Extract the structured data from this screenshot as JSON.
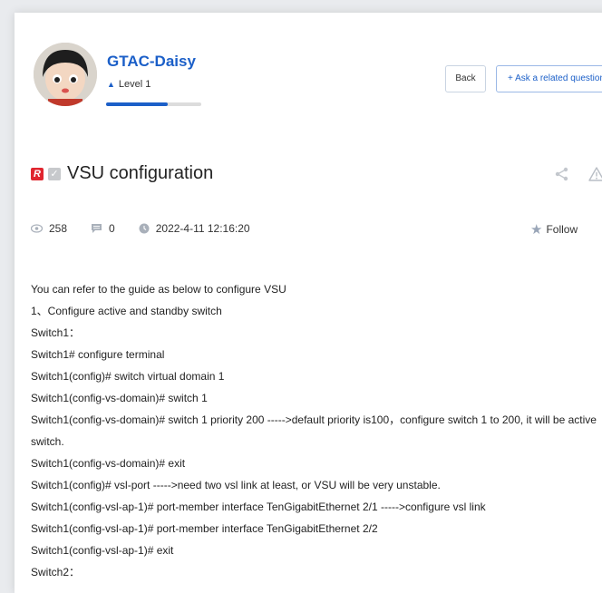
{
  "user": {
    "name": "GTAC-Daisy",
    "level": "Level 1",
    "level_progress": 0.65
  },
  "actions": {
    "back_label": "Back",
    "ask_label": "+ Ask a related question"
  },
  "post": {
    "title": "VSU configuration",
    "views": "258",
    "comments": "0",
    "datetime": "2022-4-11 12:16:20",
    "follow_label": "Follow"
  },
  "icons": {
    "brand_logo": "R",
    "checkbox": "✓",
    "share": "share-icon",
    "warning": "warning-icon"
  },
  "content_lines": [
    "You can refer to the guide as below to configure VSU",
    "1、Configure  active and standby switch",
    "Switch1：",
    "Switch1# configure terminal",
    "Switch1(config)# switch virtual domain 1",
    "Switch1(config-vs-domain)# switch 1",
    "Switch1(config-vs-domain)# switch 1 priority 200    ----->default priority is100，configure switch 1 to 200, it will be active",
    "switch.",
    "Switch1(config-vs-domain)# exit",
    "Switch1(config)# vsl-port      ----->need two vsl link at least, or VSU will be very unstable.",
    "Switch1(config-vsl-ap-1)# port-member interface TenGigabitEthernet 2/1          ----->configure vsl link",
    "Switch1(config-vsl-ap-1)# port-member interface TenGigabitEthernet 2/2",
    "Switch1(config-vsl-ap-1)# exit",
    "Switch2："
  ],
  "colors": {
    "accent": "#1b5fc8",
    "brand_red": "#e0262f"
  }
}
